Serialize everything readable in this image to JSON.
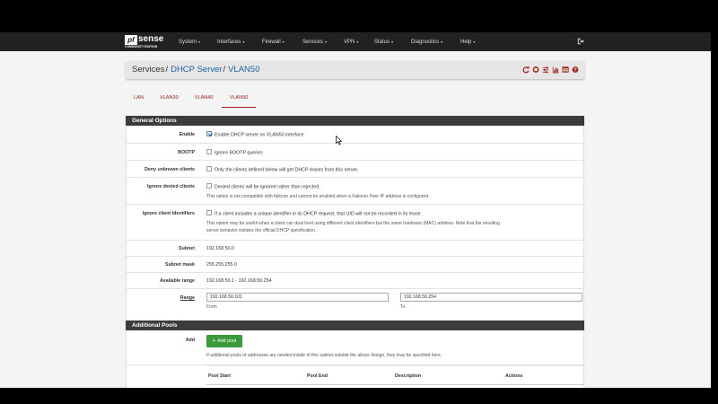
{
  "logo": {
    "pf": "pf",
    "sense": "sense",
    "edition": "COMMUNITY EDITION"
  },
  "nav": {
    "items": [
      {
        "label": "System"
      },
      {
        "label": "Interfaces"
      },
      {
        "label": "Firewall"
      },
      {
        "label": "Services"
      },
      {
        "label": "VPN"
      },
      {
        "label": "Status"
      },
      {
        "label": "Diagnostics"
      },
      {
        "label": "Help"
      }
    ],
    "logout_icon": "sign-out-icon"
  },
  "breadcrumb": {
    "items": [
      "Services",
      "DHCP Server",
      "VLAN50"
    ],
    "separator": "/"
  },
  "breadcrumb_icons": [
    "reload-icon",
    "stop-icon",
    "sliders-icon",
    "bar-chart-icon",
    "list-icon",
    "help-icon"
  ],
  "tabs": [
    {
      "label": "LAN",
      "active": false
    },
    {
      "label": "VLAN30",
      "active": false
    },
    {
      "label": "VLAN40",
      "active": false
    },
    {
      "label": "VLAN50",
      "active": true
    }
  ],
  "general": {
    "title": "General Options",
    "enable": {
      "label": "Enable",
      "text": "Enable DHCP server on VLAN50 interface",
      "checked": true
    },
    "bootp": {
      "label": "BOOTP",
      "text": "Ignore BOOTP queries",
      "checked": false
    },
    "deny_unknown": {
      "label": "Deny unknown clients",
      "text": "Only the clients defined below will get DHCP leases from this server.",
      "checked": false
    },
    "ignore_denied": {
      "label": "Ignore denied clients",
      "text": "Denied clients will be ignored rather than rejected.",
      "help": "This option is not compatible with failover and cannot be enabled when a Failover Peer IP address is configured.",
      "checked": false
    },
    "ignore_identifiers": {
      "label": "Ignore client identifiers",
      "text": "If a client includes a unique identifier in its DHCP request, that UID will not be recorded in its lease.",
      "help1": "This option may be useful when a client can dual boot using different client identifiers but the same hardware (MAC) address. Note that the resulting",
      "help2": "server behavior violates the official DHCP specification.",
      "checked": false
    },
    "subnet": {
      "label": "Subnet",
      "value": "192.168.50.0"
    },
    "subnet_mask": {
      "label": "Subnet mask",
      "value": "255.255.255.0"
    },
    "available_range": {
      "label": "Available range",
      "value": "192.168.50.1 - 192.168.50.254"
    },
    "range": {
      "label": "Range",
      "from_value": "192.168.50.101",
      "to_value": "192.168.50.254",
      "from_label": "From",
      "to_label": "To"
    }
  },
  "pools": {
    "title": "Additional Pools",
    "add_label": "Add",
    "add_button": "Add pool",
    "help": "If additional pools of addresses are needed inside of this subnet outside the above Range, they may be specified here.",
    "columns": [
      "Pool Start",
      "Pool End",
      "Description",
      "Actions"
    ]
  },
  "colors": {
    "navbar": "#212121",
    "accent": "#a32416",
    "link": "#1e5fa0",
    "panel_head": "#3c3c3c",
    "add_button": "#3a9a3a"
  }
}
